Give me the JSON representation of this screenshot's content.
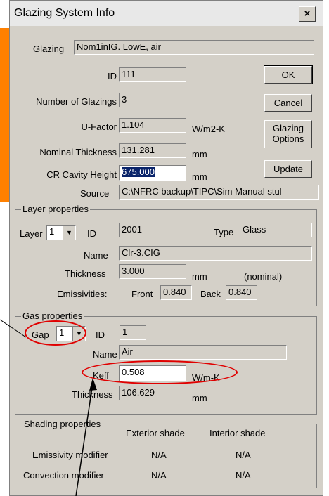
{
  "window": {
    "title": "Glazing System Info",
    "close_label": "×"
  },
  "glazing": {
    "label": "Glazing",
    "value": "Nom1inIG. LowE, air"
  },
  "id": {
    "label": "ID",
    "value": "111"
  },
  "num_glazings": {
    "label": "Number of Glazings",
    "value": "3"
  },
  "ufactor": {
    "label": "U-Factor",
    "value": "1.104",
    "unit": "W/m2-K"
  },
  "nominal_thickness": {
    "label": "Nominal Thickness",
    "value": "131.281",
    "unit": "mm"
  },
  "cr_cavity": {
    "label": "CR Cavity Height",
    "value": "675.000",
    "unit": "mm"
  },
  "source": {
    "label": "Source",
    "value": "C:\\NFRC backup\\TIPC\\Sim Manual stul"
  },
  "buttons": {
    "ok": "OK",
    "cancel": "Cancel",
    "glazing_options_1": "Glazing",
    "glazing_options_2": "Options",
    "update": "Update"
  },
  "layer": {
    "title": "Layer properties",
    "layer_label": "Layer",
    "layer_value": "1",
    "id_label": "ID",
    "id_value": "2001",
    "type_label": "Type",
    "type_value": "Glass",
    "name_label": "Name",
    "name_value": "Clr-3.CIG",
    "thickness_label": "Thickness",
    "thickness_value": "3.000",
    "thickness_unit": "mm",
    "thickness_note": "(nominal)",
    "emiss_label": "Emissivities:",
    "front_label": "Front",
    "front_value": "0.840",
    "back_label": "Back",
    "back_value": "0.840"
  },
  "gas": {
    "title": "Gas properties",
    "gap_label": "Gap",
    "gap_value": "1",
    "id_label": "ID",
    "id_value": "1",
    "name_label": "Name",
    "name_value": "Air",
    "keff_label": "Keff",
    "keff_value": "0.508",
    "keff_unit": "W/m-K",
    "thickness_label": "Thickness",
    "thickness_value": "106.629",
    "thickness_unit": "mm"
  },
  "shading": {
    "title": "Shading properties",
    "exterior": "Exterior shade",
    "interior": "Interior shade",
    "emiss_label": "Emissivity modifier",
    "emiss_ext": "N/A",
    "emiss_int": "N/A",
    "conv_label": "Convection modifier",
    "conv_ext": "N/A",
    "conv_int": "N/A"
  },
  "colors": {
    "annotation": "#e00000",
    "accent": "#ff8000",
    "dialog_bg": "#d4d0c8"
  }
}
